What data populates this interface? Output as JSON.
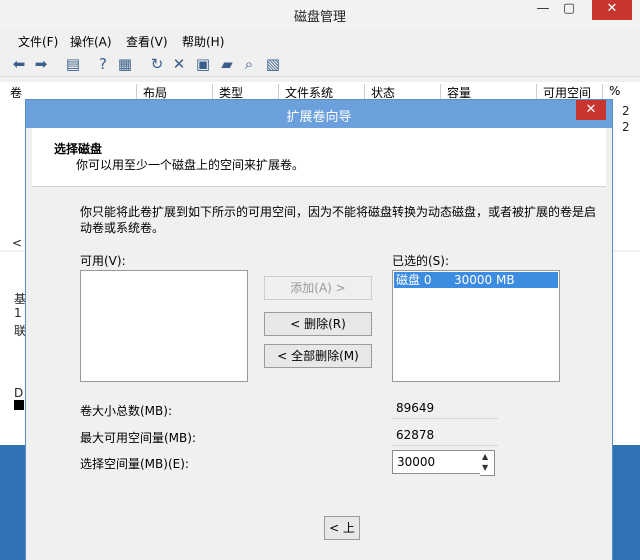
{
  "bg_window": {
    "title": "磁盘管理",
    "minimize": "—",
    "maximize": "▢",
    "close": "✕",
    "menu": [
      "文件(F)",
      "操作(A)",
      "查看(V)",
      "帮助(H)"
    ],
    "columns": [
      "卷",
      "布局",
      "类型",
      "文件系统",
      "状态",
      "容量",
      "可用空间",
      "%"
    ],
    "side_chars": [
      "2",
      "2",
      "<",
      "基",
      "1",
      "联",
      "D",
      "(("
    ]
  },
  "dialog": {
    "title": "扩展卷向导",
    "close": "✕",
    "header_title": "选择磁盘",
    "header_subtitle": "你可以用至少一个磁盘上的空间来扩展卷。",
    "description": "你只能将此卷扩展到如下所示的可用空间，因为不能将磁盘转换为动态磁盘，或者被扩展的卷是启动卷或系统卷。",
    "available_label": "可用(V):",
    "selected_label": "已选的(S):",
    "selected_item": {
      "disk": "磁盘 0",
      "size": "30000 MB"
    },
    "add_button": "添加(A) >",
    "remove_button": "< 删除(R)",
    "remove_all_button": "< 全部删除(M)",
    "total_label": "卷大小总数(MB):",
    "total_value": "89649",
    "max_label": "最大可用空间量(MB):",
    "max_value": "62878",
    "select_label": "选择空间量(MB)(E):",
    "select_value": "30000",
    "back_button": "< 上"
  }
}
